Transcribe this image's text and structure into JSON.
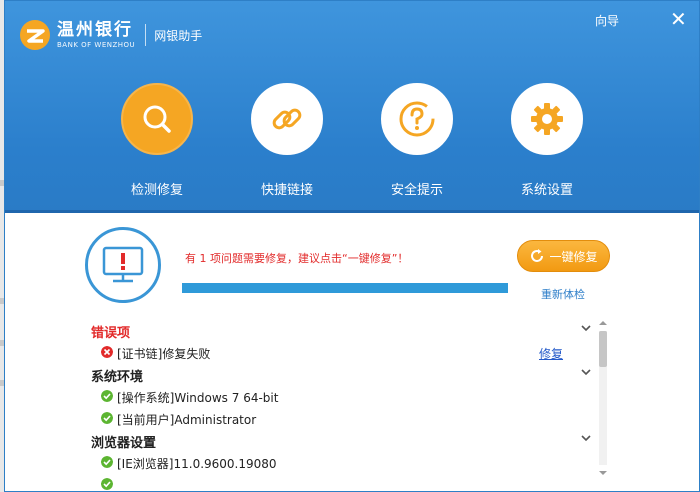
{
  "app": {
    "logo_cn": "温州银行",
    "logo_en": "BANK OF WENZHOU",
    "subtitle": "网银助手",
    "guide_label": "向导",
    "close_label": "✕"
  },
  "nav": [
    {
      "label": "检测修复",
      "icon": "search-icon",
      "active": true
    },
    {
      "label": "快捷链接",
      "icon": "link-icon",
      "active": false
    },
    {
      "label": "安全提示",
      "icon": "help-icon",
      "active": false
    },
    {
      "label": "系统设置",
      "icon": "gear-icon",
      "active": false
    }
  ],
  "status": {
    "message": "有 1 项问题需要修复，建议点击“一键修复”！",
    "progress": 1.0,
    "fix_button": "一键修复",
    "recheck_link": "重新体检"
  },
  "sections": [
    {
      "title": "错误项",
      "error": true,
      "items": [
        {
          "status": "error",
          "text": "[证书链]修复失败",
          "action": "修复"
        }
      ]
    },
    {
      "title": "系统环境",
      "error": false,
      "items": [
        {
          "status": "ok",
          "text": "[操作系统]Windows 7 64-bit"
        },
        {
          "status": "ok",
          "text": "[当前用户]Administrator"
        }
      ]
    },
    {
      "title": "浏览器设置",
      "error": false,
      "items": [
        {
          "status": "ok",
          "text": "[IE浏览器]11.0.9600.19080"
        }
      ]
    }
  ],
  "colors": {
    "header": "#2b7fcc",
    "accent_orange": "#f5a623",
    "error_red": "#e22a2a",
    "ok_green": "#5cb531",
    "link_blue": "#2f7fc9"
  }
}
